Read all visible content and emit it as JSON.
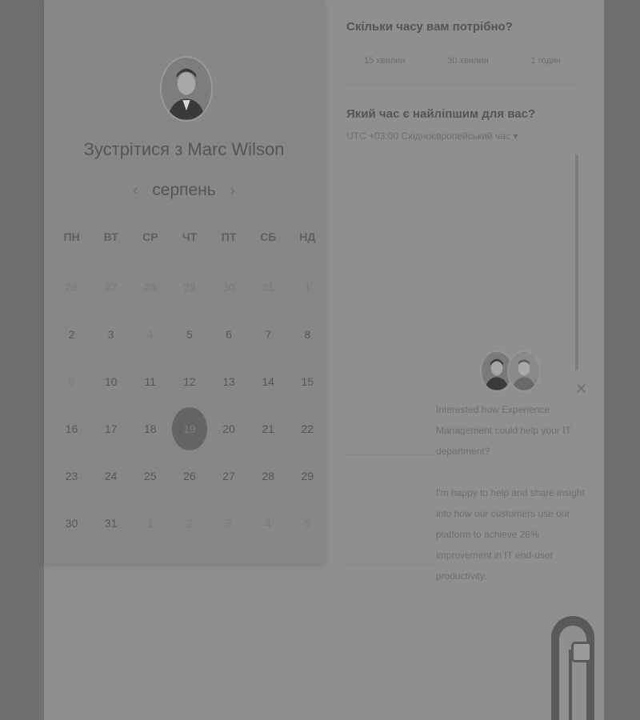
{
  "host": {
    "name": "Marc Wilson",
    "title": "Зустрітися з Marc Wilson"
  },
  "calendar": {
    "month": "серпень",
    "prev_icon": "chevron-left-icon",
    "next_icon": "chevron-right-icon",
    "weekdays": [
      "ПН",
      "ВТ",
      "СР",
      "ЧТ",
      "ПТ",
      "СБ",
      "НД"
    ],
    "weeks": [
      [
        "26",
        "27",
        "28",
        "29",
        "30",
        "31",
        "1"
      ],
      [
        "2",
        "3",
        "4",
        "5",
        "6",
        "7",
        "8"
      ],
      [
        "9",
        "10",
        "11",
        "12",
        "13",
        "14",
        "15"
      ],
      [
        "16",
        "17",
        "18",
        "19",
        "20",
        "21",
        "22"
      ],
      [
        "23",
        "24",
        "25",
        "26",
        "27",
        "28",
        "29"
      ],
      [
        "30",
        "31",
        "1",
        "2",
        "3",
        "4",
        "5"
      ]
    ],
    "selected_day": "19"
  },
  "duration": {
    "question": "Скільки часу вам потрібно?",
    "options": [
      "15 хвилин",
      "30 хвилин",
      "1 годин"
    ]
  },
  "time": {
    "question": "Який час є найліпшим для вас?",
    "timezone": "UTC +03:00 Східноєвропейський час ▾",
    "slots": [
      "15:45",
      "16:00",
      "16:15",
      "16:30"
    ]
  },
  "chat": {
    "close_icon": "close-icon",
    "message_1": "Interested how Experience Management could help your IT department?",
    "message_2": "I'm happy to help and share insight into how our customers use our platform to achieve 26% improvement in IT end-user productivity."
  },
  "colors": {
    "overlay": "#6f6f6f",
    "panel": "#878787",
    "selected_day_bg": "#646464"
  }
}
